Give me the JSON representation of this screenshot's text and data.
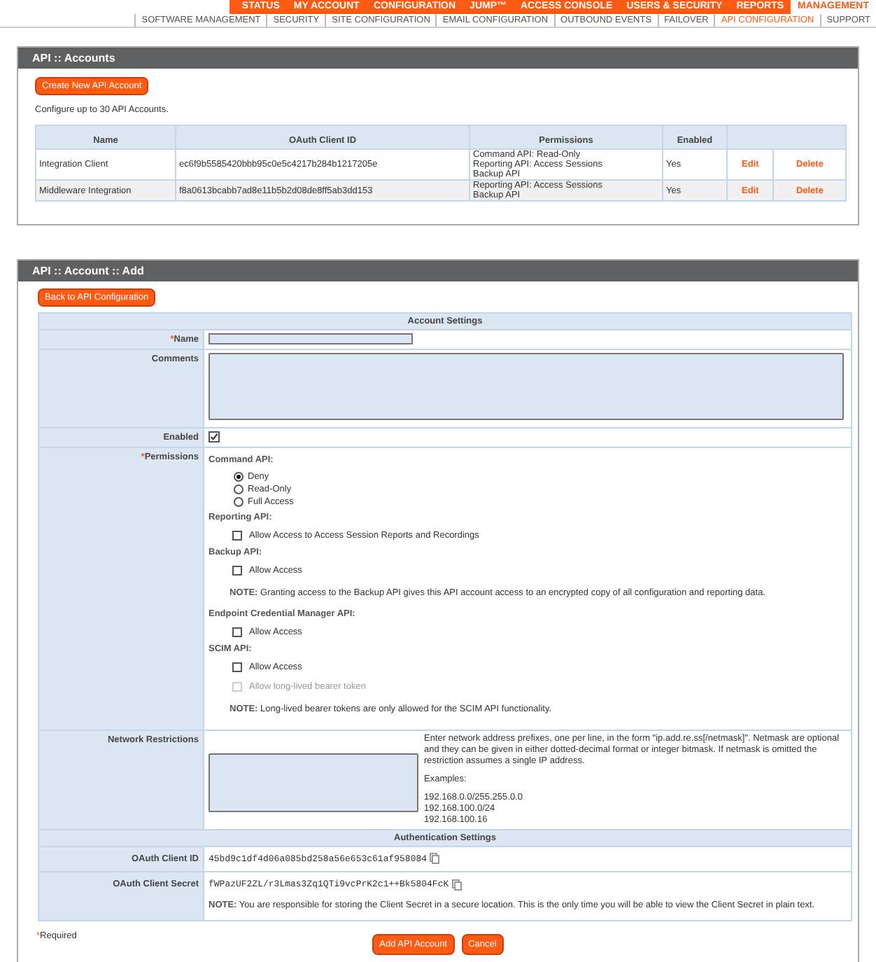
{
  "nav": {
    "items": [
      {
        "label": "STATUS",
        "selected": false
      },
      {
        "label": "MY ACCOUNT",
        "selected": false
      },
      {
        "label": "CONFIGURATION",
        "selected": false
      },
      {
        "label": "JUMP™",
        "selected": false
      },
      {
        "label": "ACCESS CONSOLE",
        "selected": false
      },
      {
        "label": "USERS & SECURITY",
        "selected": false
      },
      {
        "label": "REPORTS",
        "selected": false
      },
      {
        "label": "MANAGEMENT",
        "selected": true
      }
    ]
  },
  "subnav": {
    "items": [
      {
        "label": "SOFTWARE MANAGEMENT",
        "selected": false
      },
      {
        "label": "SECURITY",
        "selected": false
      },
      {
        "label": "SITE CONFIGURATION",
        "selected": false
      },
      {
        "label": "EMAIL CONFIGURATION",
        "selected": false
      },
      {
        "label": "OUTBOUND EVENTS",
        "selected": false
      },
      {
        "label": "FAILOVER",
        "selected": false
      },
      {
        "label": "API CONFIGURATION",
        "selected": true
      },
      {
        "label": "SUPPORT",
        "selected": false
      }
    ]
  },
  "accounts": {
    "title": "API :: Accounts",
    "create_button": "Create New API Account",
    "note": "Configure up to 30 API Accounts.",
    "columns": [
      "Name",
      "OAuth Client ID",
      "Permissions",
      "Enabled"
    ],
    "rows": [
      {
        "name": "Integration Client",
        "client_id": "ec6f9b5585420bbb95c0e5c4217b284b1217205e",
        "permissions": [
          "Command API: Read-Only",
          "Reporting API: Access Sessions",
          "Backup API"
        ],
        "enabled": "Yes",
        "edit": "Edit",
        "delete": "Delete"
      },
      {
        "name": "Middleware Integration",
        "client_id": "f8a0613bcabb7ad8e11b5b2d08de8ff5ab3dd153",
        "permissions": [
          "Reporting API: Access Sessions",
          "Backup API"
        ],
        "enabled": "Yes",
        "edit": "Edit",
        "delete": "Delete"
      }
    ]
  },
  "add": {
    "title": "API :: Account :: Add",
    "back_button": "Back to API Configuration",
    "account_settings": "Account Settings",
    "name": {
      "label": "Name",
      "mark": "*"
    },
    "comments": {
      "label": "Comments"
    },
    "enabled": {
      "label": "Enabled",
      "checked": true
    },
    "permissions": {
      "label": "Permissions",
      "mark": "*",
      "groups": [
        {
          "title": "Command API:",
          "items": [
            {
              "kind": "radio",
              "label": "Deny",
              "selected": true
            },
            {
              "kind": "radio",
              "label": "Read-Only",
              "selected": false
            },
            {
              "kind": "radio",
              "label": "Full Access",
              "selected": false
            }
          ]
        },
        {
          "title": "Reporting API:",
          "items": [
            {
              "kind": "checkbox",
              "label": "Allow Access to Access Session Reports and Recordings",
              "checked": false,
              "disabled": false
            }
          ]
        },
        {
          "title": "Backup API:",
          "items": [
            {
              "kind": "checkbox",
              "label": "Allow Access",
              "checked": false,
              "disabled": false
            },
            {
              "kind": "note",
              "text": "**NOTE:** Granting access to the Backup API gives this API account access to an encrypted copy of all configuration and reporting data."
            }
          ]
        },
        {
          "title": "Endpoint Credential Manager API:",
          "items": [
            {
              "kind": "checkbox",
              "label": "Allow Access",
              "checked": false,
              "disabled": false
            }
          ]
        },
        {
          "title": "SCIM API:",
          "items": [
            {
              "kind": "checkbox",
              "label": "Allow Access",
              "checked": false,
              "disabled": false
            },
            {
              "kind": "checkbox",
              "label": "Allow long-lived bearer token",
              "checked": false,
              "disabled": true
            },
            {
              "kind": "note",
              "text": "**NOTE:** Long-lived bearer tokens are only allowed for the SCIM API functionality."
            }
          ]
        }
      ]
    },
    "network": {
      "label": "Network Restrictions",
      "help": "Enter network address prefixes, one per line, in the form \"ip.add.re.ss[/netmask]\". Netmask are optional and they can be given in either dotted-decimal format or integer bitmask. If netmask is omitted the restriction assumes a single IP address.",
      "examples_label": "Examples:",
      "examples": [
        "192.168.0.0/255.255.0.0",
        "192.168.100.0/24",
        "192.168.100.16"
      ]
    },
    "auth_settings": "Authentication Settings",
    "client_id": {
      "label": "OAuth Client ID",
      "value": "45bd9c1df4d06a085bd258a56e653c61af958084"
    },
    "client_secret": {
      "label": "OAuth Client Secret",
      "value": "fWPazUF2ZL/r3Lmas3Zq1QTi9vcPrK2c1++Bk5804FcK",
      "note": "**NOTE:** You are responsible for storing the Client Secret in a secure location. This is the only time you will be able to view the Client Secret in plain text."
    },
    "required_note": {
      "mark": "*",
      "text": "Required"
    },
    "submit_button": "Add API Account",
    "cancel_button": "Cancel"
  }
}
